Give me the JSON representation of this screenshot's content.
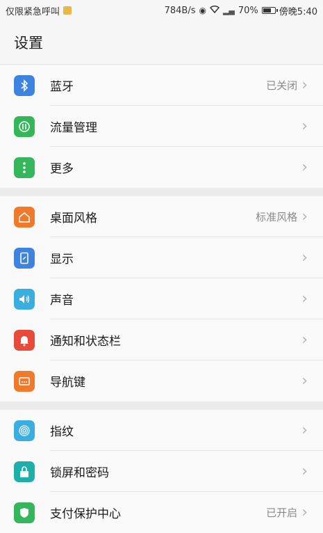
{
  "status_bar": {
    "carrier": "仅限紧急呼叫",
    "speed": "784B/s",
    "battery_percent": "70%",
    "time": "傍晚5:40"
  },
  "header": {
    "title": "设置"
  },
  "groups": [
    {
      "items": [
        {
          "label": "蓝牙",
          "value": "已关闭",
          "icon": "bluetooth-icon",
          "color": "#3d83e0"
        },
        {
          "label": "流量管理",
          "value": "",
          "icon": "data-usage-icon",
          "color": "#35b65a"
        },
        {
          "label": "更多",
          "value": "",
          "icon": "more-icon",
          "color": "#35b65a"
        }
      ]
    },
    {
      "items": [
        {
          "label": "桌面风格",
          "value": "标准风格",
          "icon": "home-style-icon",
          "color": "#f07a2a"
        },
        {
          "label": "显示",
          "value": "",
          "icon": "display-icon",
          "color": "#3d83e0"
        },
        {
          "label": "声音",
          "value": "",
          "icon": "sound-icon",
          "color": "#3aaee0"
        },
        {
          "label": "通知和状态栏",
          "value": "",
          "icon": "notification-icon",
          "color": "#e84a3c"
        },
        {
          "label": "导航键",
          "value": "",
          "icon": "navigation-key-icon",
          "color": "#f07a2a"
        }
      ]
    },
    {
      "items": [
        {
          "label": "指纹",
          "value": "",
          "icon": "fingerprint-icon",
          "color": "#3aaee0"
        },
        {
          "label": "锁屏和密码",
          "value": "",
          "icon": "lock-icon",
          "color": "#1eb0a8"
        },
        {
          "label": "支付保护中心",
          "value": "已开启",
          "icon": "payment-protection-icon",
          "color": "#35b65a"
        }
      ]
    }
  ]
}
